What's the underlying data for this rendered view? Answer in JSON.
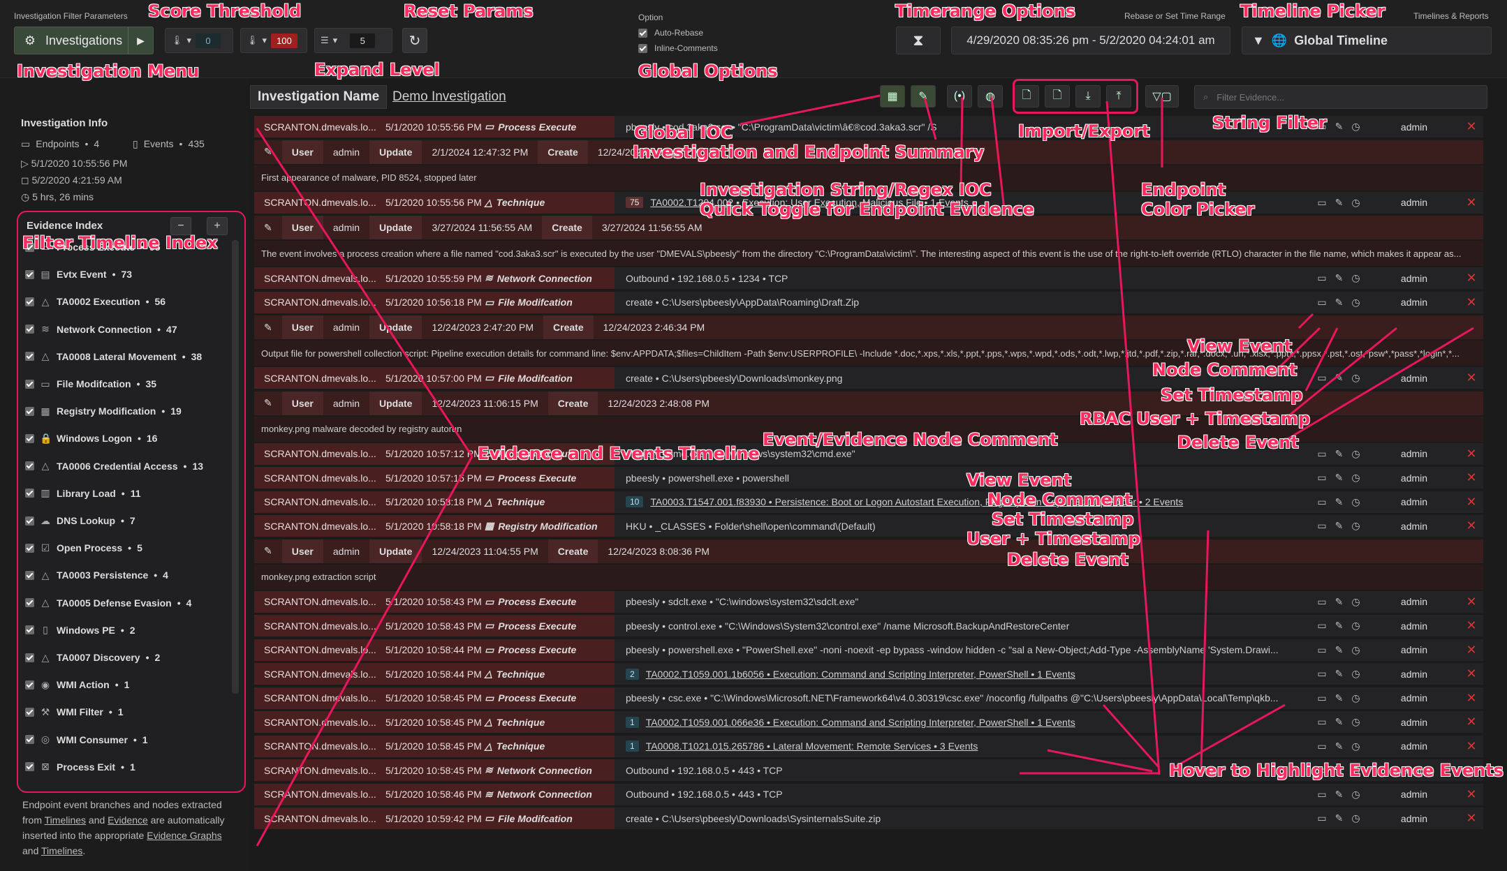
{
  "topbar": {
    "params_label": "Investigation Filter Parameters",
    "investigations_btn": "Investigations",
    "score_low": "0",
    "score_high": "100",
    "expand_level": "5",
    "option_label": "Option",
    "opt_rebase": "Auto-Rebase",
    "opt_inline": "Inline-Comments",
    "rebase_label": "Rebase or Set Time Range",
    "time_range": "4/29/2020 08:35:26 pm - 5/2/2020 04:24:01 am",
    "timelines_label": "Timelines & Reports",
    "global_timeline": "Global Timeline"
  },
  "info": {
    "title": "Investigation Info",
    "endpoints_label": "Endpoints",
    "endpoints_count": "4",
    "events_label": "Events",
    "events_count": "435",
    "start": "5/1/2020 10:55:56 PM",
    "end": "5/2/2020 4:21:59 AM",
    "duration": "5 hrs, 26 mins"
  },
  "evidence_index": {
    "title": "Evidence Index",
    "items": [
      {
        "label": "Process Execute",
        "count": "95",
        "icon": "terminal-icon"
      },
      {
        "label": "Evtx Event",
        "count": "73",
        "icon": "file-icon"
      },
      {
        "label": "TA0002 Execution",
        "count": "56",
        "icon": "triangle-icon"
      },
      {
        "label": "Network Connection",
        "count": "47",
        "icon": "wifi-icon"
      },
      {
        "label": "TA0008 Lateral Movement",
        "count": "38",
        "icon": "triangle-icon"
      },
      {
        "label": "File Modifcation",
        "count": "35",
        "icon": "folder-icon"
      },
      {
        "label": "Registry Modification",
        "count": "19",
        "icon": "grid-icon"
      },
      {
        "label": "Windows Logon",
        "count": "16",
        "icon": "lock-icon"
      },
      {
        "label": "TA0006 Credential Access",
        "count": "13",
        "icon": "triangle-icon"
      },
      {
        "label": "Library Load",
        "count": "11",
        "icon": "book-icon"
      },
      {
        "label": "DNS Lookup",
        "count": "7",
        "icon": "cloud-icon"
      },
      {
        "label": "Open Process",
        "count": "5",
        "icon": "check-icon"
      },
      {
        "label": "TA0003 Persistence",
        "count": "4",
        "icon": "triangle-icon"
      },
      {
        "label": "TA0005 Defense Evasion",
        "count": "4",
        "icon": "triangle-icon"
      },
      {
        "label": "Windows PE",
        "count": "2",
        "icon": "doc-icon"
      },
      {
        "label": "TA0007 Discovery",
        "count": "2",
        "icon": "triangle-icon"
      },
      {
        "label": "WMI Action",
        "count": "1",
        "icon": "wmi-icon"
      },
      {
        "label": "WMI Filter",
        "count": "1",
        "icon": "wrench-icon"
      },
      {
        "label": "WMI Consumer",
        "count": "1",
        "icon": "circle-icon"
      },
      {
        "label": "Process Exit",
        "count": "1",
        "icon": "exit-icon"
      }
    ]
  },
  "footer": {
    "line1": "Endpoint event branches and nodes extracted from ",
    "link1": "Timelines",
    "and1": " and ",
    "link2": "Evidence",
    "line2": " are automatically inserted into the appropriate ",
    "link3": "Evidence Graphs",
    "and2": " and ",
    "link4": "Timelines",
    "end": "."
  },
  "main": {
    "tab_name": "Investigation Name",
    "tab_demo": "Demo Investigation",
    "filter_placeholder": "Filter Evidence..."
  },
  "events": [
    {
      "kind": "row",
      "host": "SCRANTON.dmevals.lo...",
      "ts": "5/1/2020 10:55:56 PM",
      "type": "Process Execute",
      "detail": "pbeesly  •  cod.3aka3.scr  •  \"C:\\ProgramData\\victim\\â€®cod.3aka3.scr\" /S",
      "user": "admin"
    },
    {
      "kind": "note",
      "user": "admin",
      "update": "2/1/2024 12:47:32 PM",
      "create": "12/24/2023 8:01:42 PM",
      "body": "First appearance of malware, PID 8524, stopped later"
    },
    {
      "kind": "row",
      "host": "SCRANTON.dmevals.lo...",
      "ts": "5/1/2020 10:55:56 PM",
      "type": "Technique",
      "tag": "75",
      "detail": "TA0002.T1204.002  •  Execution: User Execution, Malicious File  •  1 Events",
      "user": "admin"
    },
    {
      "kind": "note",
      "user": "admin",
      "update": "3/27/2024 11:56:55 AM",
      "create": "3/27/2024 11:56:55 AM",
      "body": "The event involves a process creation where a file named \"cod.3aka3.scr\" is executed by the user \"DMEVALS\\pbeesly\" from the directory \"C:\\ProgramData\\victim\\\". The interesting aspect of this event is the use of the right-to-left override (RTLO) character in the file name, which makes it appear as..."
    },
    {
      "kind": "row",
      "host": "SCRANTON.dmevals.lo...",
      "ts": "5/1/2020 10:55:59 PM",
      "type": "Network Connection",
      "detail": "Outbound  •  192.168.0.5  •  1234  •  TCP",
      "user": "admin"
    },
    {
      "kind": "row",
      "host": "SCRANTON.dmevals.lo...",
      "ts": "5/1/2020 10:56:18 PM",
      "type": "File Modifcation",
      "detail": "create  •  C:\\Users\\pbeesly\\AppData\\Roaming\\Draft.Zip",
      "user": "admin"
    },
    {
      "kind": "note",
      "user": "admin",
      "update": "12/24/2023 2:47:20 PM",
      "create": "12/24/2023 2:46:34 PM",
      "body": "Output file for powershell collection script: Pipeline execution details for command line: $env:APPDATA;$files=ChildItem -Path $env:USERPROFILE\\ -Include *.doc,*.xps,*.xls,*.ppt,*.pps,*.wps,*.wpd,*.ods,*.odt,*.lwp,*.jtd,*.pdf,*.zip,*.rar,*.docx,*.url,*.xlsx,*.pptx,*.ppsx,*.pst,*.ost,*psw*,*pass*,*login*,*..."
    },
    {
      "kind": "row",
      "host": "SCRANTON.dmevals.lo...",
      "ts": "5/1/2020 10:57:00 PM",
      "type": "File Modifcation",
      "detail": "create  •  C:\\Users\\pbeesly\\Downloads\\monkey.png",
      "user": "admin"
    },
    {
      "kind": "note",
      "user": "admin",
      "update": "12/24/2023 11:06:15 PM",
      "create": "12/24/2023 2:48:08 PM",
      "body": "monkey.png malware decoded by registry autorun"
    },
    {
      "kind": "row",
      "host": "SCRANTON.dmevals.lo...",
      "ts": "5/1/2020 10:57:12 PM",
      "type": "Process Execute",
      "detail": "pbeesly  •  cmd.exe  •  \"C:\\windows\\system32\\cmd.exe\"",
      "user": "admin"
    },
    {
      "kind": "row",
      "host": "SCRANTON.dmevals.lo...",
      "ts": "5/1/2020 10:57:15 PM",
      "type": "Process Execute",
      "detail": "pbeesly  •  powershell.exe  •  powershell",
      "user": "admin"
    },
    {
      "kind": "row",
      "host": "SCRANTON.dmevals.lo...",
      "ts": "5/1/2020 10:58:18 PM",
      "type": "Technique",
      "tag": "10",
      "tagblue": true,
      "detail": "TA0003.T1547.001.f83930  •  Persistence: Boot or Logon Autostart Execution, Registry Run Keys / Startup Folder  •  2 Events",
      "user": "admin"
    },
    {
      "kind": "row",
      "host": "SCRANTON.dmevals.lo...",
      "ts": "5/1/2020 10:58:18 PM",
      "type": "Registry Modification",
      "detail": "HKU  •  _CLASSES  •  Folder\\shell\\open\\command\\(Default)",
      "user": "admin"
    },
    {
      "kind": "note",
      "user": "admin",
      "update": "12/24/2023 11:04:55 PM",
      "create": "12/24/2023 8:08:36 PM",
      "body": "monkey.png extraction script"
    },
    {
      "kind": "row",
      "host": "SCRANTON.dmevals.lo...",
      "ts": "5/1/2020 10:58:43 PM",
      "type": "Process Execute",
      "detail": "pbeesly  •  sdclt.exe  •  \"C:\\windows\\system32\\sdclt.exe\"",
      "user": "admin"
    },
    {
      "kind": "row",
      "host": "SCRANTON.dmevals.lo...",
      "ts": "5/1/2020 10:58:43 PM",
      "type": "Process Execute",
      "detail": "pbeesly  •  control.exe  •  \"C:\\Windows\\System32\\control.exe\" /name Microsoft.BackupAndRestoreCenter",
      "user": "admin"
    },
    {
      "kind": "row",
      "host": "SCRANTON.dmevals.lo...",
      "ts": "5/1/2020 10:58:44 PM",
      "type": "Process Execute",
      "detail": "pbeesly  •  powershell.exe  •  \"PowerShell.exe\" -noni -noexit -ep bypass -window hidden -c \"sal a New-Object;Add-Type -AssemblyName 'System.Drawi...",
      "user": "admin"
    },
    {
      "kind": "row",
      "host": "SCRANTON.dmevals.lo...",
      "ts": "5/1/2020 10:58:44 PM",
      "type": "Technique",
      "tag": "2",
      "tagblue": true,
      "detail": "TA0002.T1059.001.1b6056  •  Execution: Command and Scripting Interpreter, PowerShell  •  1 Events",
      "user": "admin"
    },
    {
      "kind": "row",
      "host": "SCRANTON.dmevals.lo...",
      "ts": "5/1/2020 10:58:45 PM",
      "type": "Process Execute",
      "detail": "pbeesly  •  csc.exe  •  \"C:\\Windows\\Microsoft.NET\\Framework64\\v4.0.30319\\csc.exe\" /noconfig /fullpaths @\"C:\\Users\\pbeesly\\AppData\\Local\\Temp\\qkb...",
      "user": "admin"
    },
    {
      "kind": "row",
      "host": "SCRANTON.dmevals.lo...",
      "ts": "5/1/2020 10:58:45 PM",
      "type": "Technique",
      "tag": "1",
      "tagblue": true,
      "detail": "TA0002.T1059.001.066e36  •  Execution: Command and Scripting Interpreter, PowerShell  •  1 Events",
      "user": "admin"
    },
    {
      "kind": "row",
      "host": "SCRANTON.dmevals.lo...",
      "ts": "5/1/2020 10:58:45 PM",
      "type": "Technique",
      "tag": "1",
      "tagblue": true,
      "detail": "TA0008.T1021.015.265786  •  Lateral Movement: Remote Services  •  3 Events",
      "user": "admin"
    },
    {
      "kind": "row",
      "host": "SCRANTON.dmevals.lo...",
      "ts": "5/1/2020 10:58:45 PM",
      "type": "Network Connection",
      "detail": "Outbound  •  192.168.0.5  •  443  •  TCP",
      "user": "admin"
    },
    {
      "kind": "row",
      "host": "SCRANTON.dmevals.lo...",
      "ts": "5/1/2020 10:58:46 PM",
      "type": "Network Connection",
      "detail": "Outbound  •  192.168.0.5  •  443  •  TCP",
      "user": "admin"
    },
    {
      "kind": "row",
      "host": "SCRANTON.dmevals.lo...",
      "ts": "5/1/2020 10:59:42 PM",
      "type": "File Modifcation",
      "detail": "create  •  C:\\Users\\pbeesly\\Downloads\\SysinternalsSuite.zip",
      "user": "admin"
    }
  ],
  "annotations": {
    "score_threshold": "Score Threshold",
    "reset_params": "Reset Params",
    "timerange_options": "Timerange Options",
    "timeline_picker": "Timeline Picker",
    "investigation_menu": "Investigation Menu",
    "expand_level": "Expand Level",
    "global_options": "Global Options",
    "global_ioc": "Global IOC",
    "inv_summary": "Investigation and Endpoint Summary",
    "import_export": "Import/Export",
    "string_filter": "String Filter",
    "string_regex_ioc": "Investigation String/Regex IOC",
    "quick_toggle": "Quick Toggle for Endpoint Evidence",
    "endpoint": "Endpoint",
    "color_picker": "Color Picker",
    "filter_index": "Filter Timeline Index",
    "view_event": "View Event",
    "node_comment": "Node Comment",
    "set_timestamp": "Set Timestamp",
    "rbac_user": "RBAC User + Timestamp",
    "delete_event": "Delete Event",
    "evidence_timeline": "Evidence and Events Timeline",
    "node_comment2": "Event/Evidence Node Comment",
    "view_event2": "View Event",
    "node_comment3": "Node Comment",
    "set_timestamp2": "Set Timestamp",
    "user_timestamp": "User + Timestamp",
    "delete_event2": "Delete Event",
    "hover": "Hover to Highlight Evidence Events"
  },
  "labels": {
    "user": "User",
    "update": "Update",
    "create": "Create"
  },
  "colors": {
    "accent": "#e8175d",
    "host_bg": "#4a1f1f",
    "note_bg": "#3a1e1e",
    "delete": "#d33333"
  }
}
